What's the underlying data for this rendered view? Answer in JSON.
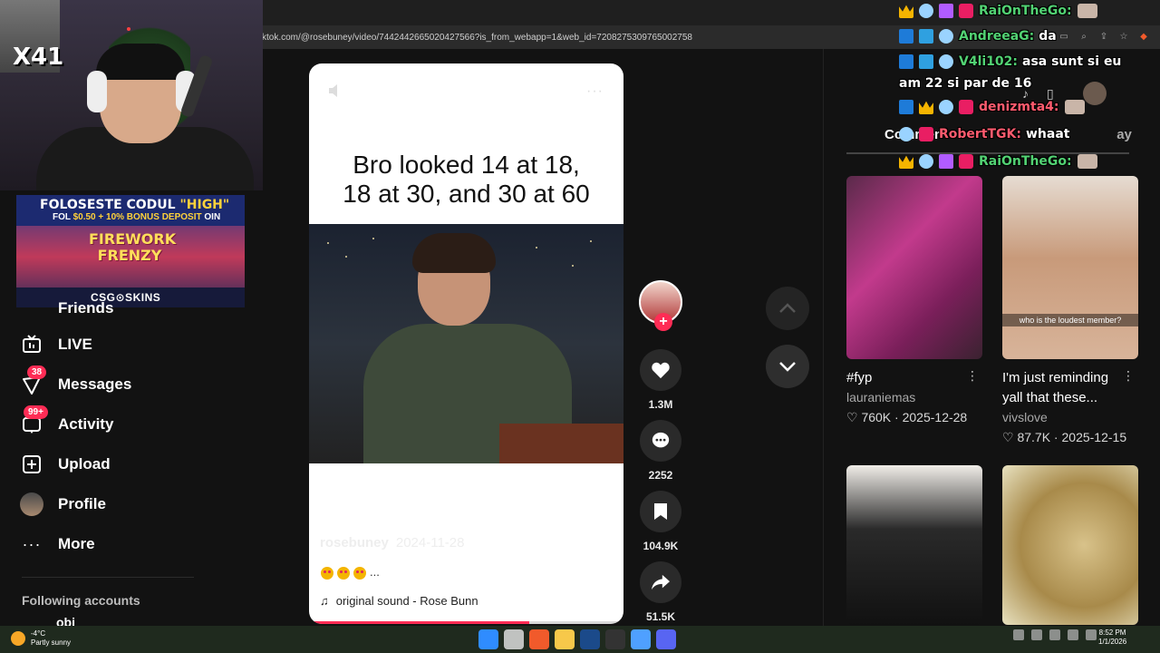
{
  "browser": {
    "url": "ktok.com/@rosebuney/video/7442442665020427566?is_from_webapp=1&web_id=7208275309765002758"
  },
  "overlay": {
    "combo_text": "X41",
    "ad_line1_pre": "FOLOSESTE CODUL ",
    "ad_line1_code": "\"HIGH\"",
    "ad_line2_pre": "FOL ",
    "ad_line2_bonus": "$0.50 + 10% BONUS DEPOSIT",
    "ad_line2_post": " OIN",
    "ad_title": "FIREWORK FRENZY",
    "ad_brand": "CSG⊙SKINS"
  },
  "sidebar": {
    "partial_item": "Friends",
    "items": [
      {
        "label": "LIVE",
        "icon": "live-tv-icon",
        "badge": ""
      },
      {
        "label": "Messages",
        "icon": "messages-icon",
        "badge": "38"
      },
      {
        "label": "Activity",
        "icon": "activity-icon",
        "badge": "99+"
      },
      {
        "label": "Upload",
        "icon": "upload-icon",
        "badge": ""
      },
      {
        "label": "Profile",
        "icon": "profile-avatar-icon",
        "badge": ""
      },
      {
        "label": "More",
        "icon": "more-icon",
        "badge": ""
      }
    ],
    "following_heading": "Following accounts",
    "following_partial": "obi"
  },
  "video": {
    "caption_line1": "Bro looked 14 at 18,",
    "caption_line2": "18 at 30, and 30 at 60",
    "author": "rosebuney",
    "date": "2024-11-28",
    "description_suffix": "...",
    "sound": "original sound - Rose Bunn",
    "progress_fraction": 0.7
  },
  "actions": {
    "likes": "1.3M",
    "comments": "2252",
    "saves": "104.9K",
    "shares": "51.5K"
  },
  "right_panel": {
    "tab_partial": "Commen",
    "tab_suffix": "ay",
    "cards": [
      {
        "title": "#fyp",
        "author": "lauraniemas",
        "likes": "760K",
        "date": "2025-12-28",
        "overlay": ""
      },
      {
        "title": "I'm just reminding yall that these...",
        "author": "vivslove",
        "likes": "87.7K",
        "date": "2025-12-15",
        "overlay": "who is the loudest member?"
      },
      {
        "title": "",
        "author": "",
        "likes": "",
        "date": "",
        "overlay": ""
      },
      {
        "title": "",
        "author": "",
        "likes": "",
        "date": "",
        "overlay": ""
      }
    ]
  },
  "chat": [
    {
      "user": "RaiOnTheGo:",
      "msg": "",
      "color": "green",
      "badges": [
        "crown",
        "bot",
        "gift",
        "red"
      ],
      "avatar": true
    },
    {
      "user": "AndreeaG:",
      "msg": "da",
      "color": "green",
      "badges": [
        "arrow",
        "sub",
        "bot"
      ],
      "avatar": false
    },
    {
      "user": "V4li102:",
      "msg": "asa sunt si eu",
      "color": "green",
      "badges": [
        "arrow",
        "sub",
        "bot"
      ],
      "avatar": false
    },
    {
      "user": "",
      "msg": "am 22 si par de 16",
      "color": "green",
      "badges": [],
      "avatar": false
    },
    {
      "user": "denizmta4:",
      "msg": "",
      "color": "red",
      "badges": [
        "arrow",
        "crown",
        "bot",
        "red"
      ],
      "avatar": true
    },
    {
      "user": "RobertTGK:",
      "msg": "whaat",
      "color": "red",
      "badges": [
        "bot",
        "red"
      ],
      "avatar": false
    },
    {
      "user": "RaiOnTheGo:",
      "msg": "",
      "color": "green",
      "badges": [
        "crown",
        "bot",
        "gift",
        "red"
      ],
      "avatar": true
    }
  ],
  "taskbar": {
    "temp": "-4°C",
    "weather": "Partly sunny",
    "time": "8:52 PM",
    "date": "1/1/2026"
  }
}
